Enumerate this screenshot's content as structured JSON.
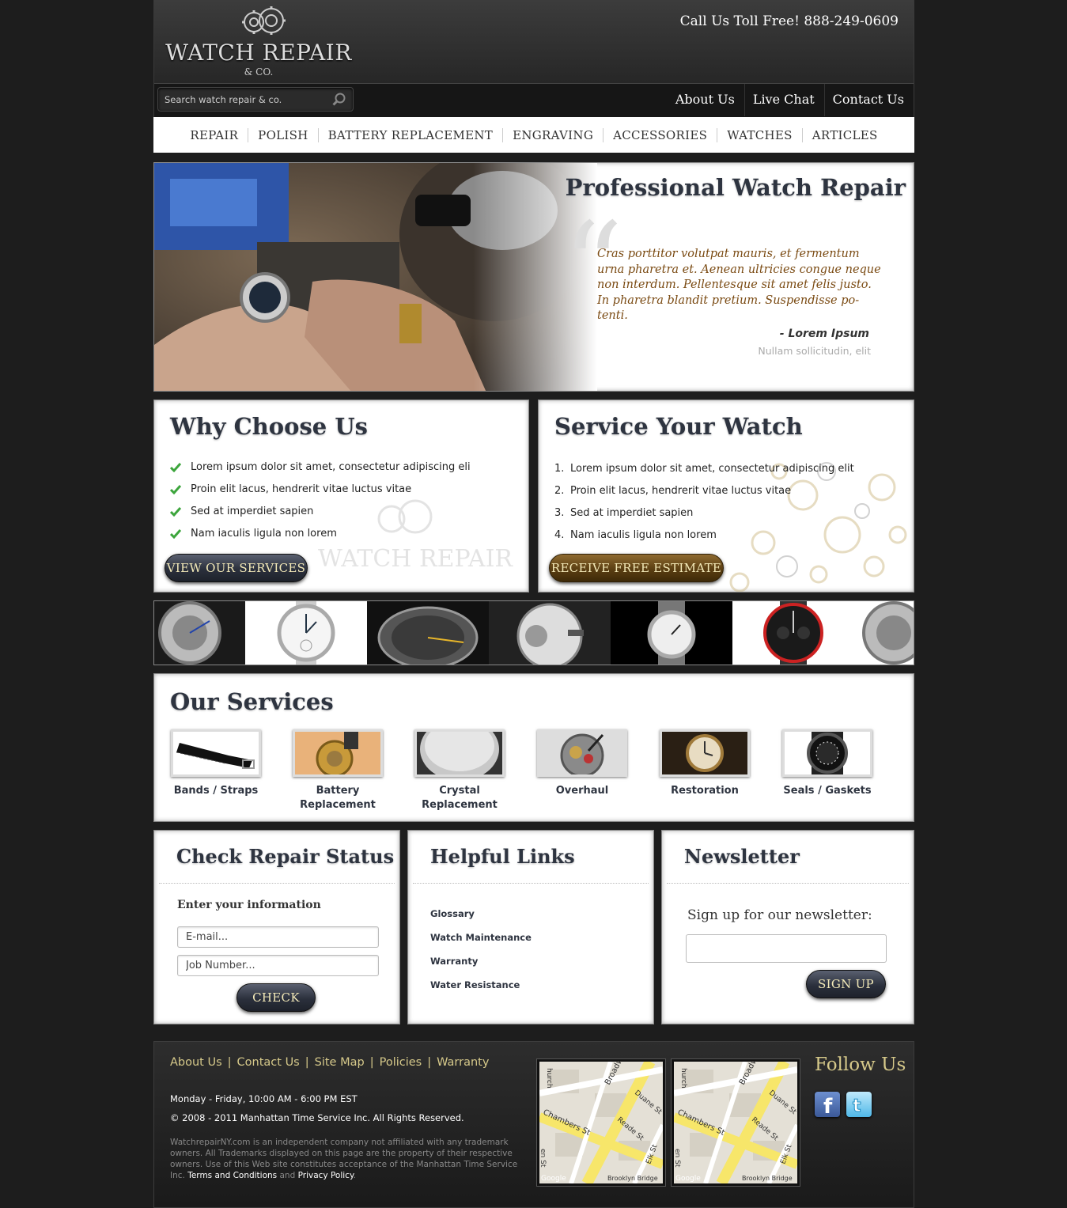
{
  "header": {
    "logo_text": "WATCH REPAIR",
    "logo_sub": "& CO.",
    "phone": "Call Us Toll Free! 888-249-0609",
    "search_placeholder": "Search watch repair & co.",
    "top_links": [
      "About Us",
      "Live Chat",
      "Contact Us"
    ]
  },
  "nav": [
    "REPAIR",
    "POLISH",
    "BATTERY REPLACEMENT",
    "ENGRAVING",
    "ACCESSORIES",
    "WATCHES",
    "ARTICLES"
  ],
  "hero": {
    "title": "Professional Watch Repair",
    "quote": "Cras porttitor volutpat mauris, et fermentum urna pharetra et. Aenean ultricies congue neque non interdum. Pellentesque sit amet felis justo. In pharetra blandit pretium. Suspendisse po-tenti.",
    "author": "- Lorem Ipsum",
    "author_role": "Nullam sollicitudin, elit"
  },
  "why": {
    "title": "Why Choose Us",
    "items": [
      "Lorem ipsum dolor sit amet, consectetur adipiscing eli",
      "Proin elit lacus, hendrerit vitae luctus vitae",
      "Sed at imperdiet sapien",
      "Nam iaculis ligula non lorem"
    ],
    "button": "VIEW OUR SERVICES"
  },
  "service": {
    "title": "Service Your Watch",
    "items": [
      "Lorem ipsum dolor sit amet, consectetur adipiscing elit",
      "Proin elit lacus, hendrerit vitae luctus vitae",
      "Sed at imperdiet sapien",
      "Nam iaculis ligula non lorem"
    ],
    "numbers": [
      "1.",
      "2.",
      "3.",
      "4."
    ],
    "button": "RECEIVE FREE ESTIMATE"
  },
  "services": {
    "title": "Our Services",
    "items": [
      {
        "label": "Bands / Straps"
      },
      {
        "label": "Battery Replacement"
      },
      {
        "label": "Crystal Replacement"
      },
      {
        "label": "Overhaul"
      },
      {
        "label": "Restoration"
      },
      {
        "label": "Seals / Gaskets"
      }
    ]
  },
  "status": {
    "title": "Check Repair Status",
    "label": "Enter your information",
    "email_placeholder": "E-mail...",
    "job_placeholder": "Job Number...",
    "button": "CHECK"
  },
  "helpful": {
    "title": "Helpful Links",
    "links": [
      "Glossary",
      "Watch Maintenance",
      "Warranty",
      "Water Resistance"
    ]
  },
  "newsletter": {
    "title": "Newsletter",
    "label": "Sign up for our newsletter:",
    "button": "SIGN UP"
  },
  "footer": {
    "links": [
      "About Us",
      "Contact Us",
      "Site Map",
      "Policies",
      "Warranty"
    ],
    "separator": "|",
    "hours": "Monday - Friday, 10:00 AM - 6:00 PM EST",
    "copyright": "© 2008 - 2011 Manhattan Time Service Inc. All Rights Reserved.",
    "disclaimer": "WatchrepairNY.com is an independent company not affiliated with any trademark owners. All Trademarks displayed on this page are the property of their respective owners. Use of this Web site constitutes acceptance of the Manhattan Time Service Inc.",
    "terms": "Terms and Conditions",
    "and": "and",
    "privacy": "Privacy Policy",
    "period": ".",
    "follow": "Follow Us",
    "map_labels": [
      "Broadway",
      "Duane St",
      "Reade St",
      "Chambers St",
      "Elk St",
      "Brooklyn Bridge",
      "Google",
      "hurch",
      "en St"
    ],
    "social": [
      "facebook-icon",
      "twitter-icon"
    ]
  }
}
